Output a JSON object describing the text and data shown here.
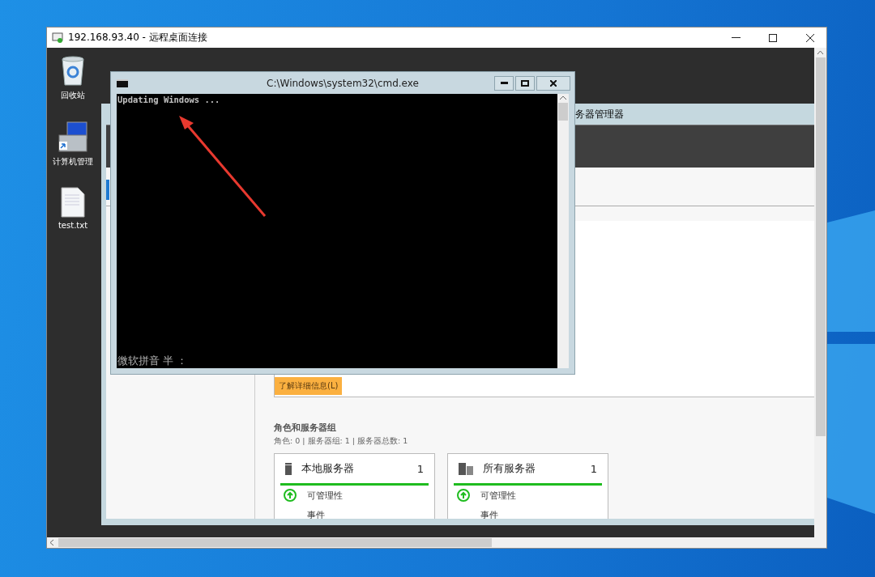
{
  "window": {
    "title": "192.168.93.40 - 远程桌面连接"
  },
  "desktop_icons": [
    {
      "label": "回收站",
      "kind": "recycle"
    },
    {
      "label": "计算机管理",
      "kind": "computer"
    },
    {
      "label": "test.txt",
      "kind": "file"
    }
  ],
  "server_manager": {
    "title": "务器管理器",
    "learn_more": "了解详细信息(L)",
    "section_title": "角色和服务器组",
    "section_summary": "角色: 0 | 服务器组: 1 | 服务器总数: 1",
    "tiles": [
      {
        "title": "本地服务器",
        "count": "1",
        "kind": "single",
        "rows": [
          {
            "label": "可管理性",
            "kind": "status"
          },
          {
            "label": "事件",
            "kind": "plain"
          }
        ]
      },
      {
        "title": "所有服务器",
        "count": "1",
        "kind": "group",
        "rows": [
          {
            "label": "可管理性",
            "kind": "status"
          },
          {
            "label": "事件",
            "kind": "plain"
          }
        ]
      }
    ]
  },
  "console": {
    "title": "C:\\Windows\\system32\\cmd.exe",
    "output": "Updating Windows ...",
    "ime_status": "微软拼音 半 ："
  }
}
